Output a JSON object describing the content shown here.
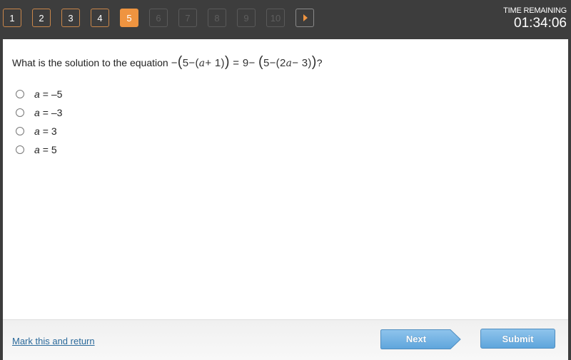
{
  "nav": {
    "questions": [
      {
        "label": "1",
        "state": "answered"
      },
      {
        "label": "2",
        "state": "answered"
      },
      {
        "label": "3",
        "state": "answered"
      },
      {
        "label": "4",
        "state": "answered"
      },
      {
        "label": "5",
        "state": "current"
      },
      {
        "label": "6",
        "state": "disabled"
      },
      {
        "label": "7",
        "state": "disabled"
      },
      {
        "label": "8",
        "state": "disabled"
      },
      {
        "label": "9",
        "state": "disabled"
      },
      {
        "label": "10",
        "state": "disabled"
      }
    ],
    "next_arrow_icon": "play-arrow-icon"
  },
  "timer": {
    "label": "TIME REMAINING",
    "value": "01:34:06"
  },
  "question": {
    "prompt": "What is the solution to the equation",
    "equation_parts": {
      "p1": "−",
      "p2": "(",
      "p3": "5−",
      "p4": "(",
      "p5": "a",
      "p6": "+ 1)",
      "p7": ")",
      "p8": " = 9− ",
      "p9": "(",
      "p10": "5−",
      "p11": "(2",
      "p12": "a",
      "p13": "− 3)",
      "p14": ")"
    },
    "suffix": "?"
  },
  "options": [
    {
      "var": "a",
      "text": "= –5"
    },
    {
      "var": "a",
      "text": "= –3"
    },
    {
      "var": "a",
      "text": "= 3"
    },
    {
      "var": "a",
      "text": "= 5"
    }
  ],
  "footer": {
    "mark_label": "Mark this and return",
    "next_label": "Next",
    "submit_label": "Submit"
  },
  "colors": {
    "accent": "#ef9440",
    "button_blue": "#6aaee0",
    "link": "#2b6a9b"
  }
}
